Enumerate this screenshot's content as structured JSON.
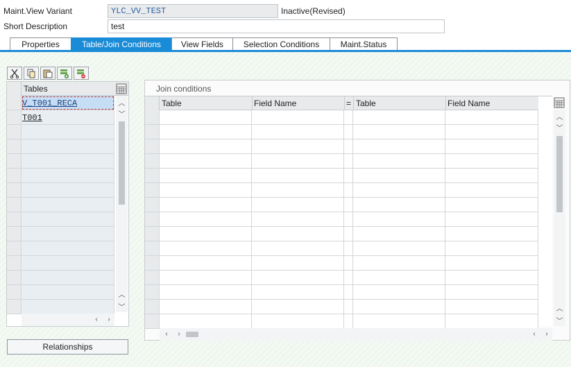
{
  "header": {
    "variant_label": "Maint.View Variant",
    "variant_value": "YLC_VV_TEST",
    "status": "Inactive(Revised)",
    "desc_label": "Short Description",
    "desc_value": "test"
  },
  "tabs": [
    {
      "label": "Properties",
      "active": false
    },
    {
      "label": "Table/Join Conditions",
      "active": true
    },
    {
      "label": "View Fields",
      "active": false
    },
    {
      "label": "Selection Conditions",
      "active": false
    },
    {
      "label": "Maint.Status",
      "active": false
    }
  ],
  "toolbar": {
    "icons": [
      "cut-icon",
      "copy-icon",
      "paste-icon",
      "insert-row-icon",
      "delete-row-icon"
    ]
  },
  "tables_grid": {
    "header": "Tables",
    "rows": [
      "V_T001_RECA",
      "T001",
      "",
      "",
      "",
      "",
      "",
      "",
      "",
      "",
      "",
      "",
      "",
      "",
      ""
    ],
    "selected_row": 0
  },
  "join_grid": {
    "group_label": "Join conditions",
    "columns": [
      "Table",
      "Field Name",
      "=",
      "Table",
      "Field Name"
    ],
    "row_count": 15
  },
  "buttons": {
    "relationships": "Relationships"
  },
  "colors": {
    "accent": "#1a8bd6",
    "selection": "#c6def5"
  }
}
